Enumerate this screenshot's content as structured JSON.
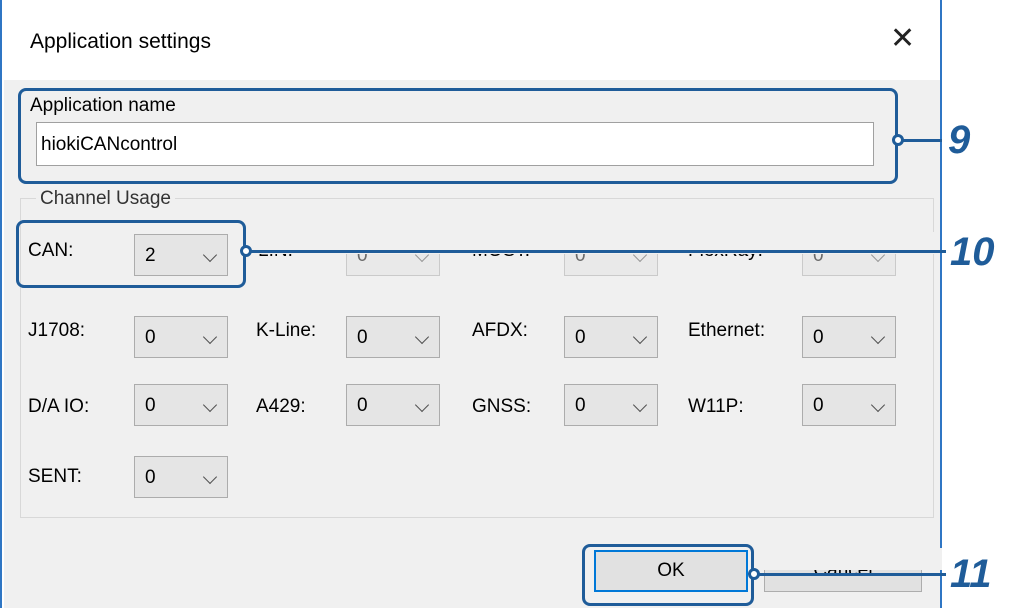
{
  "window": {
    "title": "Application settings",
    "close_icon": "close-icon"
  },
  "app_name": {
    "label": "Application name",
    "value": "hiokiCANcontrol"
  },
  "channel_usage": {
    "title": "Channel Usage",
    "rows": [
      [
        {
          "label": "CAN:",
          "value": "2"
        },
        {
          "label": "LIN:",
          "value": "0"
        },
        {
          "label": "MOST:",
          "value": "0"
        },
        {
          "label": "FlexRay:",
          "value": "0"
        }
      ],
      [
        {
          "label": "J1708:",
          "value": "0"
        },
        {
          "label": "K-Line:",
          "value": "0"
        },
        {
          "label": "AFDX:",
          "value": "0"
        },
        {
          "label": "Ethernet:",
          "value": "0"
        }
      ],
      [
        {
          "label": "D/A IO:",
          "value": "0"
        },
        {
          "label": "A429:",
          "value": "0"
        },
        {
          "label": "GNSS:",
          "value": "0"
        },
        {
          "label": "W11P:",
          "value": "0"
        }
      ],
      [
        {
          "label": "SENT:",
          "value": "0"
        }
      ]
    ]
  },
  "buttons": {
    "ok": "OK",
    "cancel": "Cancel"
  },
  "callouts": {
    "c9": "9",
    "c10": "10",
    "c11": "11"
  },
  "colors": {
    "callout": "#1f5c99",
    "window_border": "#2f76c4",
    "ok_focus": "#0078d7"
  }
}
